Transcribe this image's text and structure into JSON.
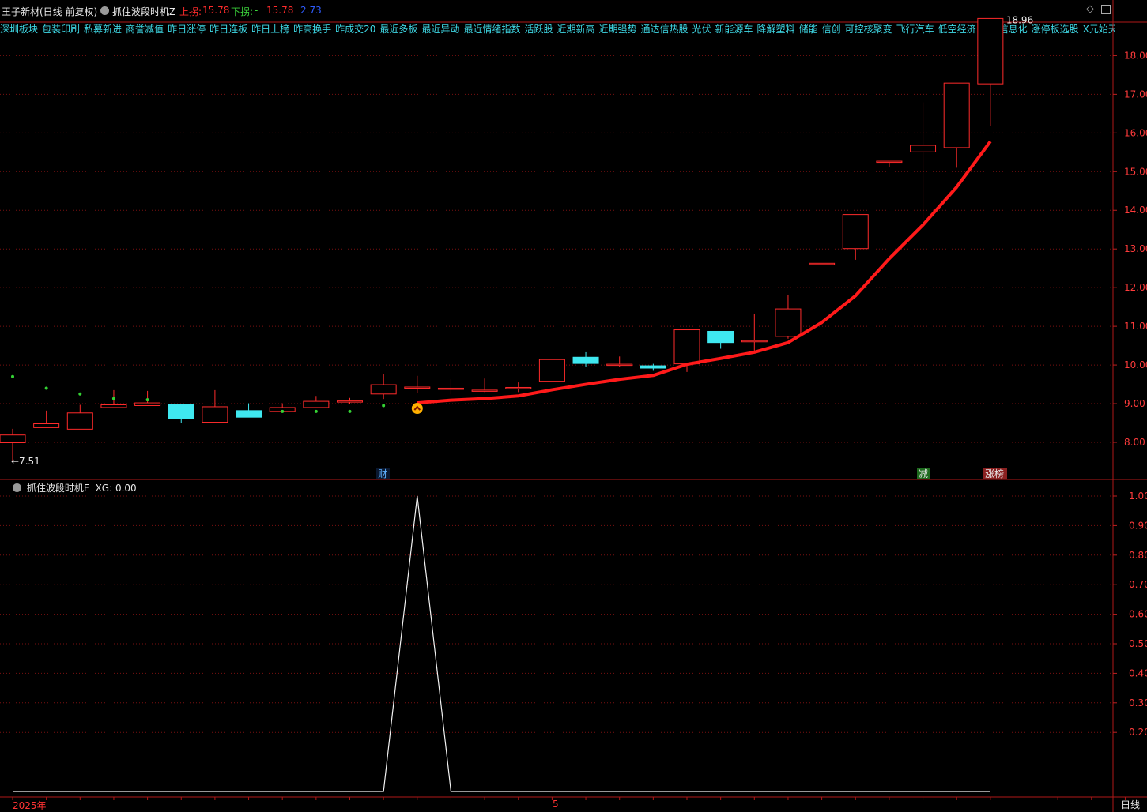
{
  "header": {
    "stock_title": "王子新材(日线 前复权)",
    "indicator_main": "抓住波段时机Z",
    "upper_label": "上拐:",
    "upper_value": "15.78",
    "lower_label": "下拐:",
    "lower_value": "-",
    "extra_value_1": "15.78",
    "extra_value_2": "2.73",
    "colors": {
      "title": "#e8e8e8",
      "red": "#ff2b2b",
      "green": "#3bd23b",
      "blue": "#2f5cff"
    }
  },
  "tags": [
    "深圳板块",
    "包装印刷",
    "私募新进",
    "商誉减值",
    "昨日涨停",
    "昨日连板",
    "昨日上榜",
    "昨高换手",
    "昨成交20",
    "最近多板",
    "最近异动",
    "最近情绪指数",
    "活跃股",
    "近期新高",
    "近期强势",
    "通达信热股",
    "光伏",
    "新能源车",
    "降解塑料",
    "储能",
    "信创",
    "可控核聚变",
    "飞行汽车",
    "低空经济",
    "军工信息化",
    "涨停板选股",
    "X元始天尊竞价"
  ],
  "markers": {
    "cai": "财",
    "jian": "减",
    "zhangbang": "涨榜",
    "max_label": "18.96",
    "min_label": "←7.51"
  },
  "lower_panel": {
    "title": "抓住波段时机F",
    "xg_label": "XG:",
    "xg_value": "0.00"
  },
  "bottom": {
    "date_start": "2025年",
    "date_mid": "5",
    "period": "日线"
  },
  "chart_data": [
    {
      "type": "candlestick",
      "name": "main-price",
      "ylim": [
        7.1,
        19.1
      ],
      "yticks": [
        "8.00",
        "9.00",
        "10.00",
        "11.00",
        "12.00",
        "13.00",
        "14.00",
        "15.00",
        "16.00",
        "17.00",
        "18.00"
      ],
      "candles": [
        {
          "o": 7.99,
          "h": 8.35,
          "l": 7.51,
          "c": 8.19,
          "dot": 9.7
        },
        {
          "o": 8.38,
          "h": 8.82,
          "l": 8.38,
          "c": 8.48,
          "dot": 9.4
        },
        {
          "o": 8.34,
          "h": 8.97,
          "l": 8.34,
          "c": 8.76,
          "dot": 9.25
        },
        {
          "o": 8.9,
          "h": 9.35,
          "l": 8.9,
          "c": 8.97,
          "dot": 9.13
        },
        {
          "o": 8.95,
          "h": 9.33,
          "l": 8.95,
          "c": 9.02,
          "dot": 9.1
        },
        {
          "o": 8.97,
          "h": 8.97,
          "l": 8.5,
          "c": 8.62,
          "dot": null
        },
        {
          "o": 8.52,
          "h": 9.35,
          "l": 8.52,
          "c": 8.92,
          "dot": null
        },
        {
          "o": 8.82,
          "h": 9.01,
          "l": 8.65,
          "c": 8.65,
          "dot": null
        },
        {
          "o": 8.8,
          "h": 9.01,
          "l": 8.8,
          "c": 8.9,
          "dot": 8.8
        },
        {
          "o": 8.9,
          "h": 9.2,
          "l": 8.9,
          "c": 9.06,
          "dot": 8.8
        },
        {
          "o": 9.07,
          "h": 9.15,
          "l": 9.0,
          "c": 9.07,
          "dot": 8.8
        },
        {
          "o": 9.25,
          "h": 9.76,
          "l": 9.12,
          "c": 9.49,
          "dot": 8.95
        },
        {
          "o": 9.43,
          "h": 9.72,
          "l": 9.28,
          "c": 9.43,
          "dot": null
        },
        {
          "o": 9.4,
          "h": 9.63,
          "l": 9.24,
          "c": 9.4,
          "dot": null
        },
        {
          "o": 9.35,
          "h": 9.65,
          "l": 9.3,
          "c": 9.35,
          "dot": null
        },
        {
          "o": 9.42,
          "h": 9.55,
          "l": 9.3,
          "c": 9.42,
          "dot": null
        },
        {
          "o": 9.58,
          "h": 10.14,
          "l": 9.58,
          "c": 10.14,
          "dot": null
        },
        {
          "o": 10.2,
          "h": 10.33,
          "l": 9.95,
          "c": 10.04,
          "dot": null
        },
        {
          "o": 10.02,
          "h": 10.22,
          "l": 9.95,
          "c": 10.02,
          "dot": null
        },
        {
          "o": 9.98,
          "h": 10.03,
          "l": 9.85,
          "c": 9.92,
          "dot": null
        },
        {
          "o": 10.03,
          "h": 10.91,
          "l": 9.82,
          "c": 10.91,
          "dot": null
        },
        {
          "o": 10.87,
          "h": 10.87,
          "l": 10.42,
          "c": 10.58,
          "dot": null
        },
        {
          "o": 10.63,
          "h": 11.33,
          "l": 10.36,
          "c": 10.63,
          "dot": null
        },
        {
          "o": 10.74,
          "h": 11.82,
          "l": 10.68,
          "c": 11.45,
          "dot": null
        },
        {
          "o": 12.63,
          "h": 12.63,
          "l": 12.63,
          "c": 12.63,
          "dot": null
        },
        {
          "o": 13.01,
          "h": 13.89,
          "l": 12.72,
          "c": 13.89,
          "dot": null
        },
        {
          "o": 15.27,
          "h": 15.27,
          "l": 15.11,
          "c": 15.27,
          "dot": null
        },
        {
          "o": 15.51,
          "h": 16.79,
          "l": 13.75,
          "c": 15.68,
          "dot": null
        },
        {
          "o": 15.62,
          "h": 17.29,
          "l": 15.1,
          "c": 17.29,
          "dot": null
        },
        {
          "o": 17.27,
          "h": 18.96,
          "l": 16.19,
          "c": 18.96,
          "dot": null
        }
      ],
      "trend_line": [
        {
          "i": 12,
          "v": 9.02
        },
        {
          "i": 13,
          "v": 9.09
        },
        {
          "i": 14,
          "v": 9.13
        },
        {
          "i": 15,
          "v": 9.2
        },
        {
          "i": 16,
          "v": 9.36
        },
        {
          "i": 17,
          "v": 9.5
        },
        {
          "i": 18,
          "v": 9.63
        },
        {
          "i": 19,
          "v": 9.73
        },
        {
          "i": 20,
          "v": 10.02
        },
        {
          "i": 21,
          "v": 10.17
        },
        {
          "i": 22,
          "v": 10.33
        },
        {
          "i": 23,
          "v": 10.58
        },
        {
          "i": 24,
          "v": 11.1
        },
        {
          "i": 25,
          "v": 11.79
        },
        {
          "i": 26,
          "v": 12.75
        },
        {
          "i": 27,
          "v": 13.62
        },
        {
          "i": 28,
          "v": 14.6
        },
        {
          "i": 29,
          "v": 15.78
        }
      ],
      "signal_index": 12,
      "colors": {
        "up": "#ff2b2b",
        "down": "#3fe8f0",
        "trend": "#ff1a1a",
        "signal": "#ffb000",
        "dot": "#34d234"
      }
    },
    {
      "type": "line",
      "name": "XG",
      "ylim": [
        0,
        1.06
      ],
      "yticks": [
        "0.20",
        "0.30",
        "0.40",
        "0.50",
        "0.60",
        "0.70",
        "0.80",
        "0.90",
        "1.00"
      ],
      "series": [
        {
          "values": [
            0,
            0,
            0,
            0,
            0,
            0,
            0,
            0,
            0,
            0,
            0,
            0,
            1,
            0,
            0,
            0,
            0,
            0,
            0,
            0,
            0,
            0,
            0,
            0,
            0,
            0,
            0,
            0,
            0,
            0
          ]
        }
      ],
      "colors": {
        "line": "#f2f2f2"
      }
    }
  ]
}
